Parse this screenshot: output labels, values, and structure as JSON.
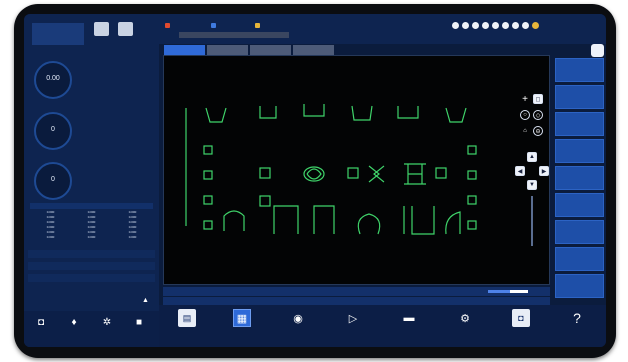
{
  "header": {
    "logo_text": "",
    "left_icons": [
      {
        "name": "home-icon",
        "label": ""
      },
      {
        "name": "settings-icon",
        "label": ""
      }
    ],
    "menu": [
      {
        "label": "",
        "color": "#e04a2f"
      },
      {
        "label": "",
        "color": "#3f7be0"
      },
      {
        "label": "",
        "color": "#e6b53a"
      }
    ],
    "status_dots": 9,
    "datetime": ""
  },
  "gauges": [
    {
      "value": "0.00",
      "label": ""
    },
    {
      "value": "0",
      "label": ""
    },
    {
      "value": "0",
      "label": ""
    }
  ],
  "coord_table": {
    "columns": [
      "",
      "",
      "",
      ""
    ],
    "rows": [
      [
        "",
        "0.000",
        "0.000",
        "0.000"
      ],
      [
        "",
        "0.000",
        "0.000",
        "0.000"
      ],
      [
        "",
        "0.000",
        "0.000",
        "0.000"
      ],
      [
        "",
        "0.000",
        "0.000",
        "0.000"
      ],
      [
        "",
        "0.000",
        "0.000",
        "0.000"
      ],
      [
        "",
        "0.000",
        "0.000",
        "0.000"
      ]
    ]
  },
  "left_bottom_buttons": [
    {
      "icon": "camera-icon",
      "label": ""
    },
    {
      "icon": "pen-icon",
      "label": ""
    },
    {
      "icon": "gear-icon",
      "label": ""
    },
    {
      "icon": "lock-icon",
      "label": ""
    }
  ],
  "tabs": [
    {
      "label": "",
      "active": true
    },
    {
      "label": "",
      "active": false
    },
    {
      "label": "",
      "active": false
    },
    {
      "label": "",
      "active": false
    }
  ],
  "right_buttons": [
    "",
    "",
    "",
    "",
    "",
    "",
    "",
    "",
    ""
  ],
  "canvas": {
    "message": ""
  },
  "info": {
    "row1_left": "",
    "row1_mid": "",
    "row1_right": "",
    "progress_label": "",
    "progress_fraction": 0.55,
    "row2_left": "",
    "row2_right": ""
  },
  "bottom_buttons": [
    {
      "icon": "file-icon",
      "label": "",
      "active": false
    },
    {
      "icon": "image-icon",
      "label": "",
      "active": true
    },
    {
      "icon": "globe-icon",
      "label": "",
      "active": false
    },
    {
      "icon": "play-icon",
      "label": "",
      "active": false
    },
    {
      "icon": "monitor-icon",
      "label": "",
      "active": false
    },
    {
      "icon": "gear-icon",
      "label": "",
      "active": false
    },
    {
      "icon": "camera-icon",
      "label": "",
      "active": false
    },
    {
      "icon": "help-icon",
      "label": "",
      "active": false
    }
  ]
}
